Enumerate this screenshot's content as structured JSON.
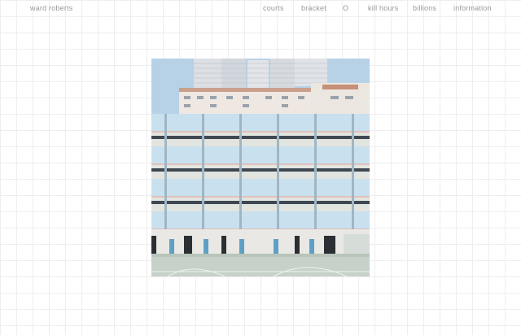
{
  "site": {
    "title": "ward roberts"
  },
  "nav": {
    "items": [
      {
        "label": "courts"
      },
      {
        "label": "bracket"
      },
      {
        "label": "O"
      },
      {
        "label": "kill hours"
      },
      {
        "label": "billions"
      },
      {
        "label": "information"
      }
    ]
  },
  "colors": {
    "grid": "#eeeeee",
    "nav_text": "#9a9a9a",
    "sky": "#b8d3e8",
    "facade": "#c3dcea",
    "court": "#c6d2c9"
  },
  "photo": {
    "subject": "pastel apartment building facade above a basketball court"
  }
}
